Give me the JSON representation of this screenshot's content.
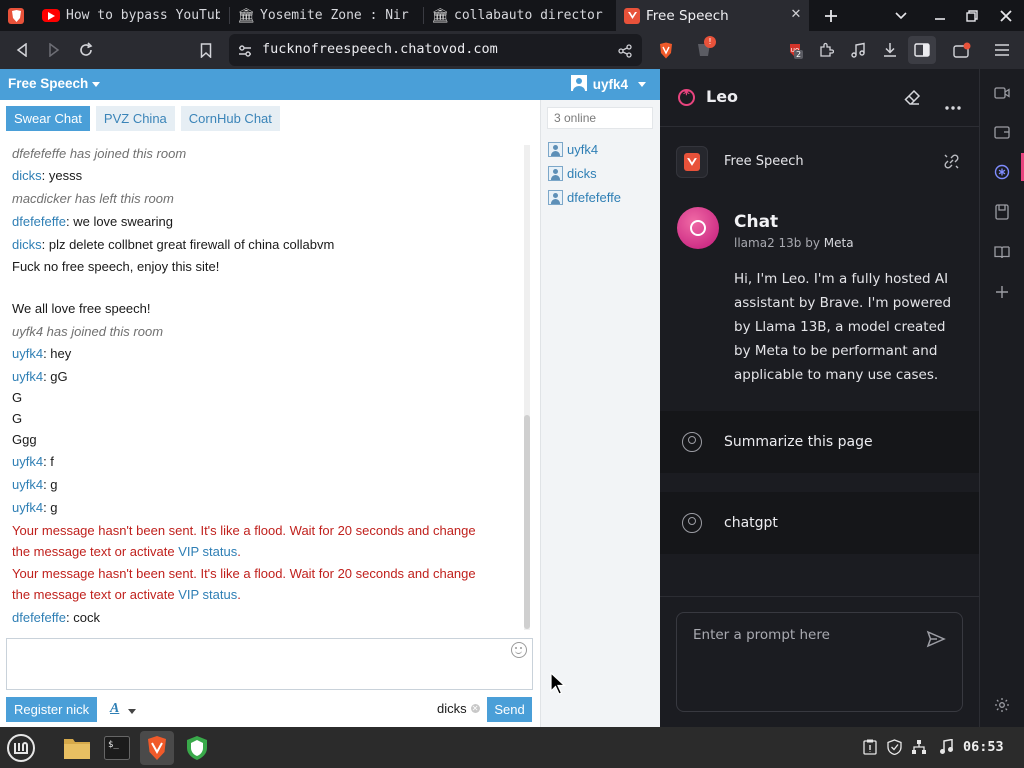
{
  "tabs": [
    {
      "title": "How to bypass YouTube",
      "favicon": "youtube-icon"
    },
    {
      "title": "Yosemite Zone : Nir",
      "favicon": "building-icon"
    },
    {
      "title": "collabauto director",
      "favicon": "building-icon"
    },
    {
      "title": "Free Speech",
      "favicon": "chatovod-icon",
      "active": true
    }
  ],
  "toolbar": {
    "url": "fucknofreespeech.chatovod.com",
    "rewards_badge": "!",
    "shields_count": "2"
  },
  "chat": {
    "room_title": "Free Speech",
    "current_user": "uyfk4",
    "room_tabs": [
      "Swear Chat",
      "PVZ China",
      "CornHub Chat"
    ],
    "online_count": "3 online",
    "users": [
      "uyfk4",
      "dicks",
      "dfefefeffe"
    ],
    "messages": [
      {
        "type": "sys",
        "text": "dfefefeffe has joined this room"
      },
      {
        "type": "msg",
        "nick": "dicks",
        "text": ": yesss"
      },
      {
        "type": "sys",
        "text": "macdicker has left this room"
      },
      {
        "type": "msg",
        "nick": "dfefefeffe",
        "text": ": we love swearing"
      },
      {
        "type": "msg",
        "nick": "dicks",
        "text": ": plz delete collbnet great firewall of china collabvm"
      },
      {
        "type": "plain",
        "text": "Fuck no free speech, enjoy this site!"
      },
      {
        "type": "plain",
        "text": "We all love free speech!"
      },
      {
        "type": "sys",
        "text": "uyfk4 has joined this room"
      },
      {
        "type": "msg",
        "nick": "uyfk4",
        "text": ": hey"
      },
      {
        "type": "msg",
        "nick": "uyfk4",
        "text": ": gG"
      },
      {
        "type": "plain",
        "text": "G"
      },
      {
        "type": "plain",
        "text": "G"
      },
      {
        "type": "plain",
        "text": "Ggg"
      },
      {
        "type": "msg",
        "nick": "uyfk4",
        "text": ": f"
      },
      {
        "type": "msg",
        "nick": "uyfk4",
        "text": ": g"
      },
      {
        "type": "msg",
        "nick": "uyfk4",
        "text": ": g"
      },
      {
        "type": "err",
        "line1": "Your message hasn't been sent. It's like a flood. Wait for 20 seconds and change",
        "line2": "the message text or activate ",
        "link": "VIP status",
        "end": "."
      },
      {
        "type": "err",
        "line1": "Your message hasn't been sent. It's like a flood. Wait for 20 seconds and change",
        "line2": "the message text or activate ",
        "link": "VIP status",
        "end": "."
      },
      {
        "type": "msg",
        "nick": "dfefefeffe",
        "text": ": cock"
      }
    ],
    "compose_value": "",
    "register_label": "Register nick",
    "font_label": "A",
    "recipient": "dicks",
    "send_label": "Send"
  },
  "leo": {
    "title": "Leo",
    "page_name": "Free Speech",
    "chat_title": "Chat",
    "model": "llama2 13b",
    "by": "by",
    "vendor": "Meta",
    "intro": "Hi, I'm Leo. I'm a fully hosted AI assistant by Brave. I'm powered by Llama 13B, a model created by Meta to be performant and applicable to many use cases.",
    "suggestions": [
      "Summarize this page",
      "chatgpt"
    ],
    "input_placeholder": "Enter a prompt here"
  },
  "taskbar": {
    "clock": "06:53"
  },
  "colors": {
    "chat_accent": "#4a9fd8",
    "nick_link": "#2f7fb5",
    "error_text": "#c0211d",
    "leo_accent": "#e8447e",
    "browser_chrome": "#2a2b31"
  }
}
